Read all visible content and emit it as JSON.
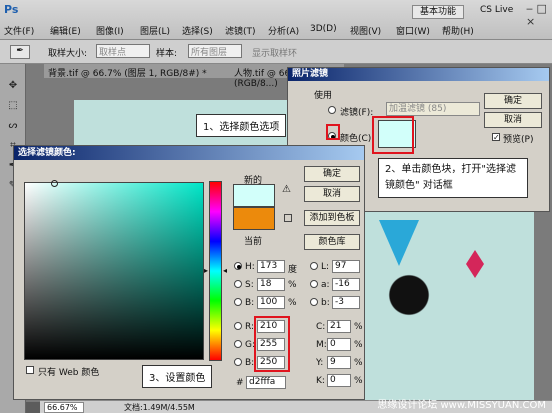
{
  "app": {
    "logo": "Ps",
    "workspace": "基本功能",
    "cslive": "CS Live"
  },
  "menu": [
    "文件(F)",
    "编辑(E)",
    "图像(I)",
    "图层(L)",
    "选择(S)",
    "滤镜(T)",
    "分析(A)",
    "3D(D)",
    "视图(V)",
    "窗口(W)",
    "帮助(H)"
  ],
  "options": {
    "sample_size_label": "取样大小:",
    "sample_size_value": "取样点",
    "sample_label": "样本:",
    "sample_value": "所有图层",
    "show_ring": "显示取样环"
  },
  "doc_tabs": [
    "背景.tif @ 66.7% (图层 1, RGB/8#) *",
    "人物.tif @ 66.7%(RGB/8...)"
  ],
  "status": {
    "zoom": "66.67%",
    "doc": "文档:1.49M/4.55M"
  },
  "photo_filter": {
    "title": "照片滤镜",
    "group": "使用",
    "filter_label": "滤镜(F):",
    "filter_value": "加温滤镜 (85)",
    "color_label": "颜色(C):",
    "ok": "确定",
    "cancel": "取消",
    "preview": "预览(P)",
    "color": "#d2fffa"
  },
  "color_picker": {
    "title": "选择滤镜颜色:",
    "new_label": "新的",
    "current_label": "当前",
    "new_color": "#d2fffa",
    "current_color": "#ec8a0c",
    "ok": "确定",
    "cancel": "取消",
    "add_swatch": "添加到色板",
    "library": "颜色库",
    "web_only": "只有 Web 颜色",
    "H": "173",
    "H_unit": "度",
    "S": "18",
    "S_unit": "%",
    "B": "100",
    "B_unit": "%",
    "R": "210",
    "G": "255",
    "Bl": "250",
    "L": "97",
    "a": "-16",
    "b": "-3",
    "C": "21",
    "M": "0",
    "Y": "9",
    "K": "0",
    "pct": "%",
    "hex": "d2fffa"
  },
  "callouts": {
    "one": "1、选择颜色选项",
    "two": "2、单击颜色块，打开\"选择滤镜颜色\" 对话框",
    "three": "3、设置颜色"
  },
  "watermark": "思缘设计论坛 www.MISSYUAN.COM"
}
